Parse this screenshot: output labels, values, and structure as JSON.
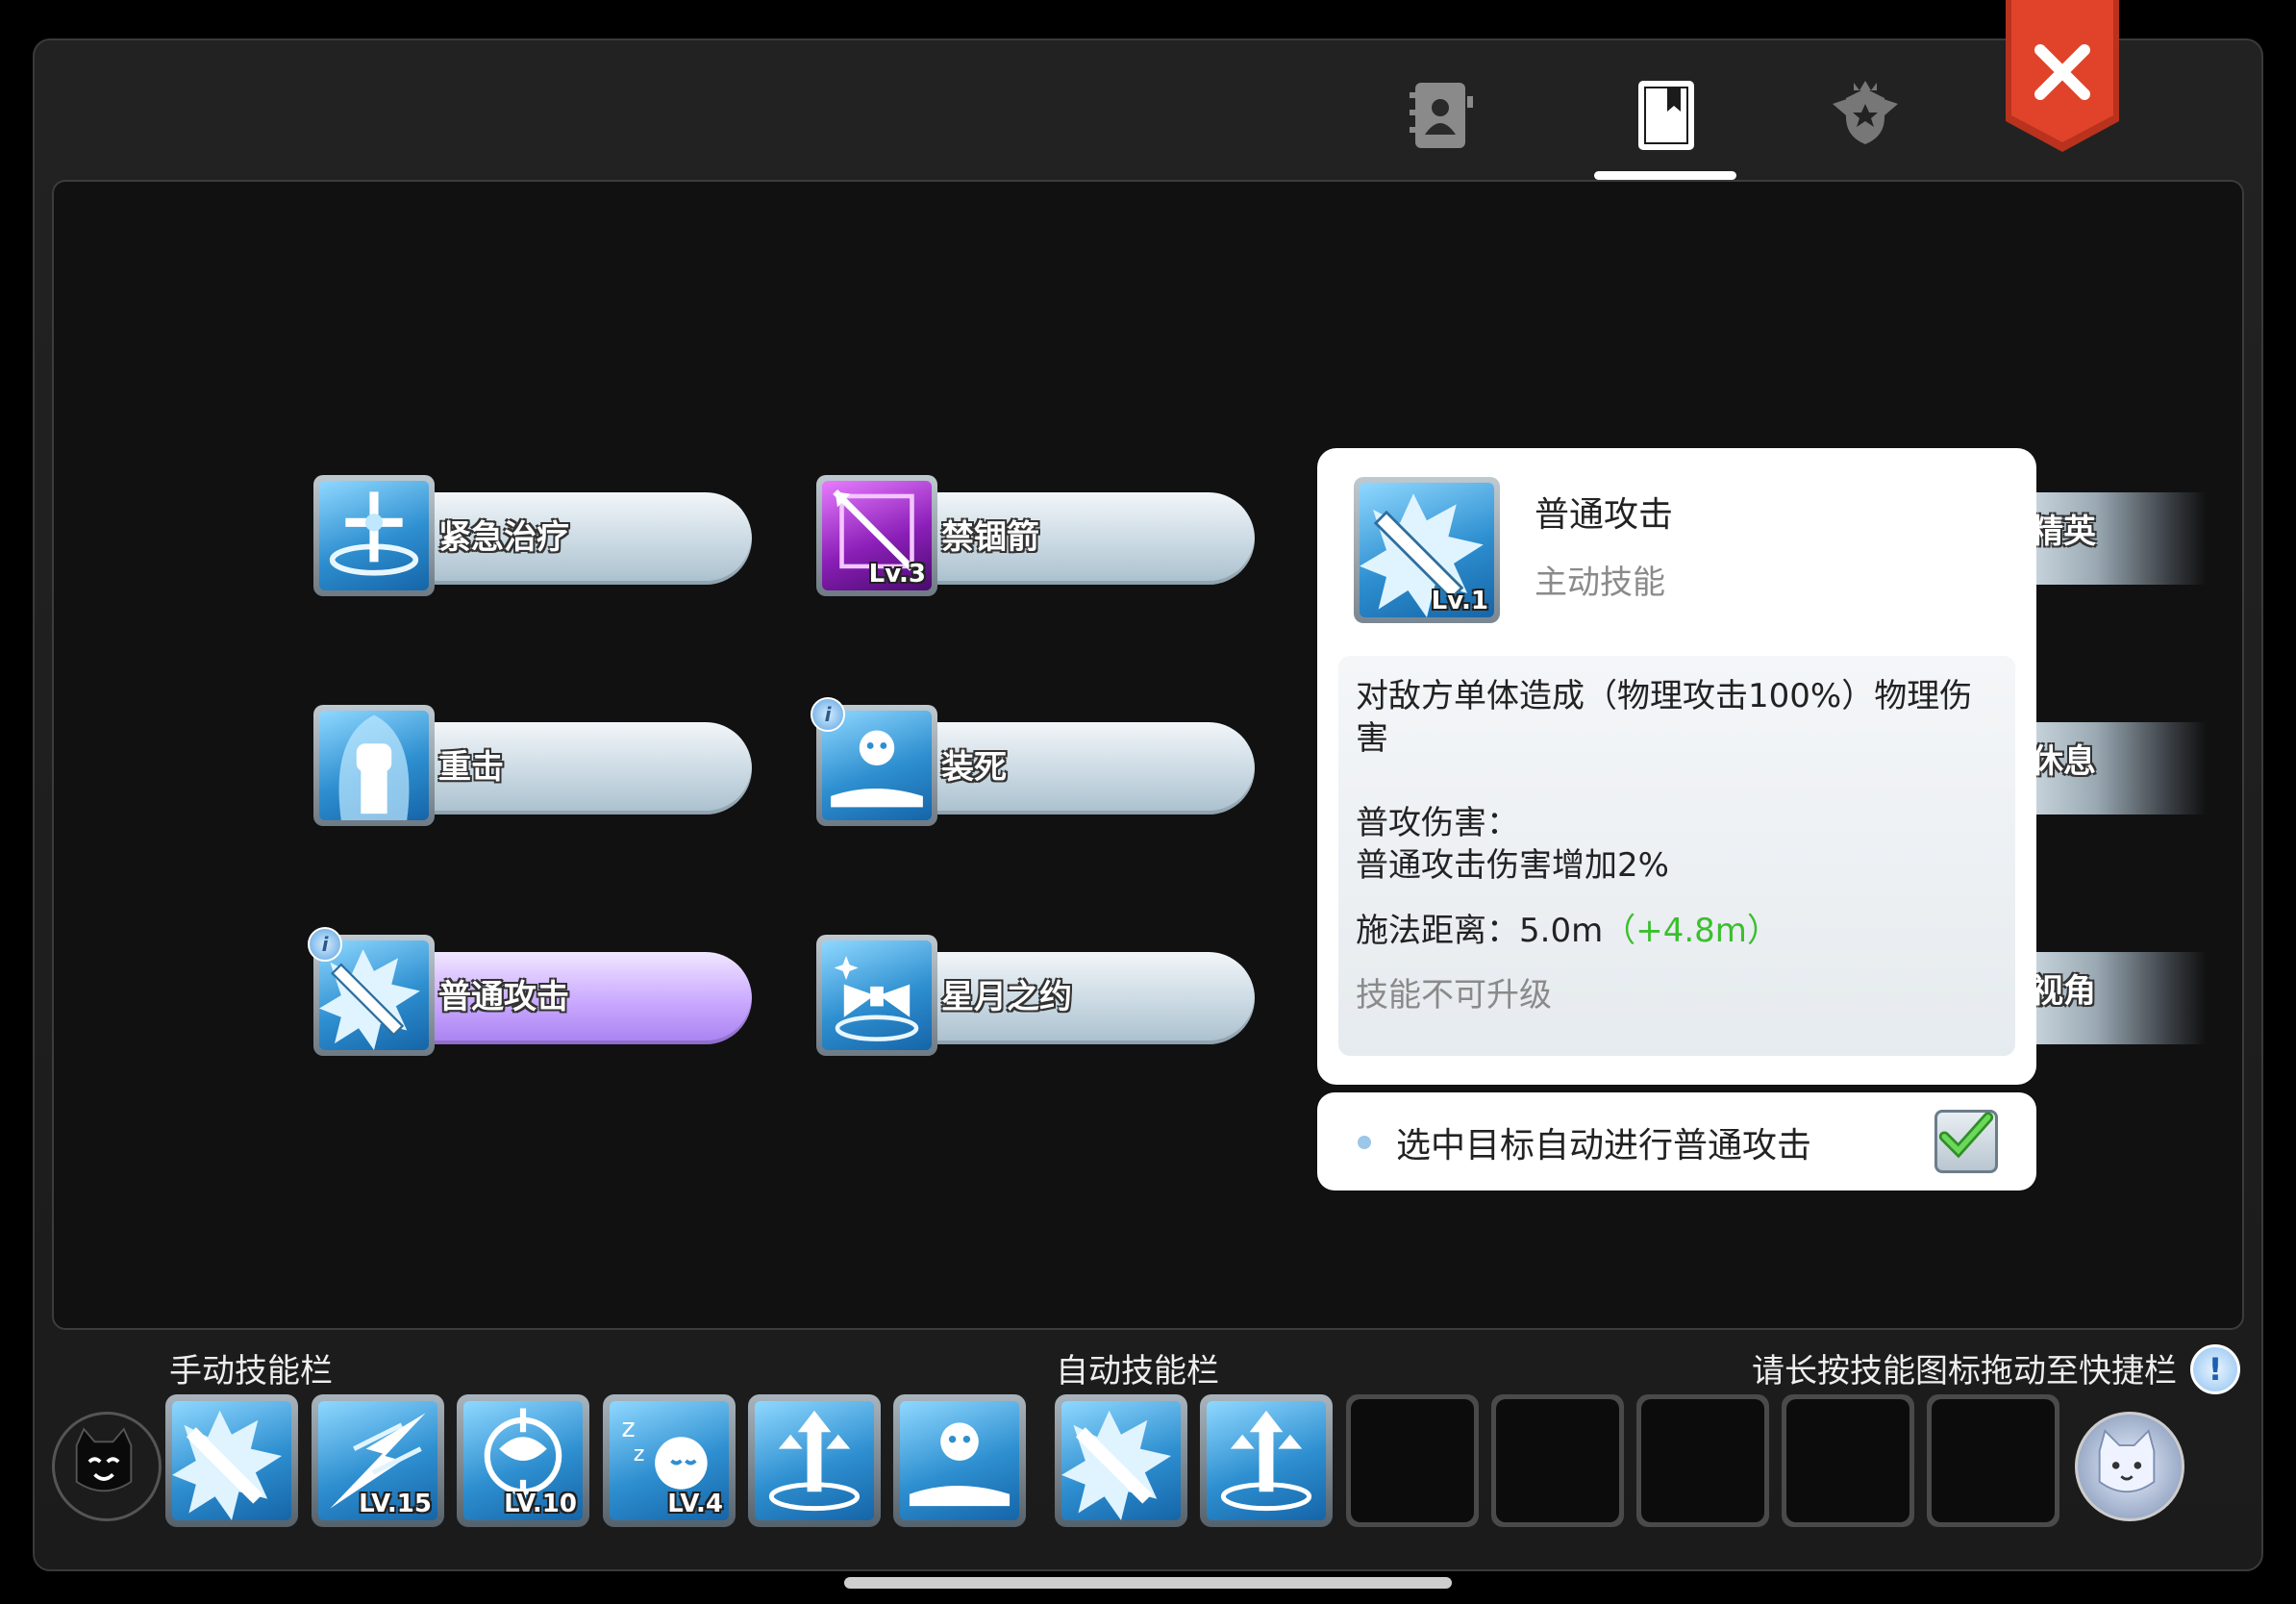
{
  "tabs": [
    {
      "name": "profile-tab",
      "icon": "contact-book-icon",
      "active": false
    },
    {
      "name": "skills-tab",
      "icon": "bookmark-book-icon",
      "active": true
    },
    {
      "name": "rank-tab",
      "icon": "star-shield-wings-icon",
      "active": false
    }
  ],
  "close_icon": "close-icon",
  "skills": {
    "healing": {
      "label": "紧急治疗",
      "icon": "holy-cross-icon"
    },
    "heavy": {
      "label": "重击",
      "icon": "fist-icon"
    },
    "attack": {
      "label": "普通攻击",
      "icon": "sword-burst-icon"
    },
    "arrow": {
      "label": "禁锢箭",
      "icon": "cage-arrow-icon",
      "level": "Lv.3"
    },
    "feign": {
      "label": "装死",
      "icon": "lying-body-icon",
      "info": "i"
    },
    "star": {
      "label": "星月之约",
      "icon": "bow-pact-icon"
    },
    "attack_info": "i"
  },
  "cutoff_skills": [
    "精英",
    "休息",
    "视角"
  ],
  "tooltip": {
    "name": "普通攻击",
    "type": "主动技能",
    "level": "Lv.1",
    "description": "对敌方单体造成（物理攻击100%）物理伤害",
    "sub_title": "普攻伤害：",
    "sub_text": "普通攻击伤害增加2%",
    "range_label": "施法距离：",
    "range_value": "5.0m",
    "range_bonus": "（+4.8m）",
    "upgrade_note": "技能不可升级"
  },
  "auto_attack": {
    "label": "选中目标自动进行普通攻击",
    "checked": true
  },
  "bottom": {
    "manual_label": "手动技能栏",
    "auto_label": "自动技能栏",
    "hint": "请长按技能图标拖动至快捷栏",
    "hint_icon": "!",
    "manual_slots": [
      {
        "icon": "sword-burst-icon",
        "level": ""
      },
      {
        "icon": "lightning-slash-icon",
        "level": "LV.15"
      },
      {
        "icon": "whirlwind-icon",
        "level": "LV.10"
      },
      {
        "icon": "sleep-icon",
        "level": "LV.4"
      },
      {
        "icon": "arrow-rise-icon",
        "level": ""
      },
      {
        "icon": "lying-body-icon",
        "level": ""
      }
    ],
    "auto_slots": [
      {
        "icon": "sword-burst-icon",
        "level": ""
      },
      {
        "icon": "arrow-rise-icon",
        "level": ""
      }
    ]
  },
  "colors": {
    "accent_green": "#3bbf2e",
    "close_red": "#e0432a",
    "active_purple": "#b48cff"
  }
}
